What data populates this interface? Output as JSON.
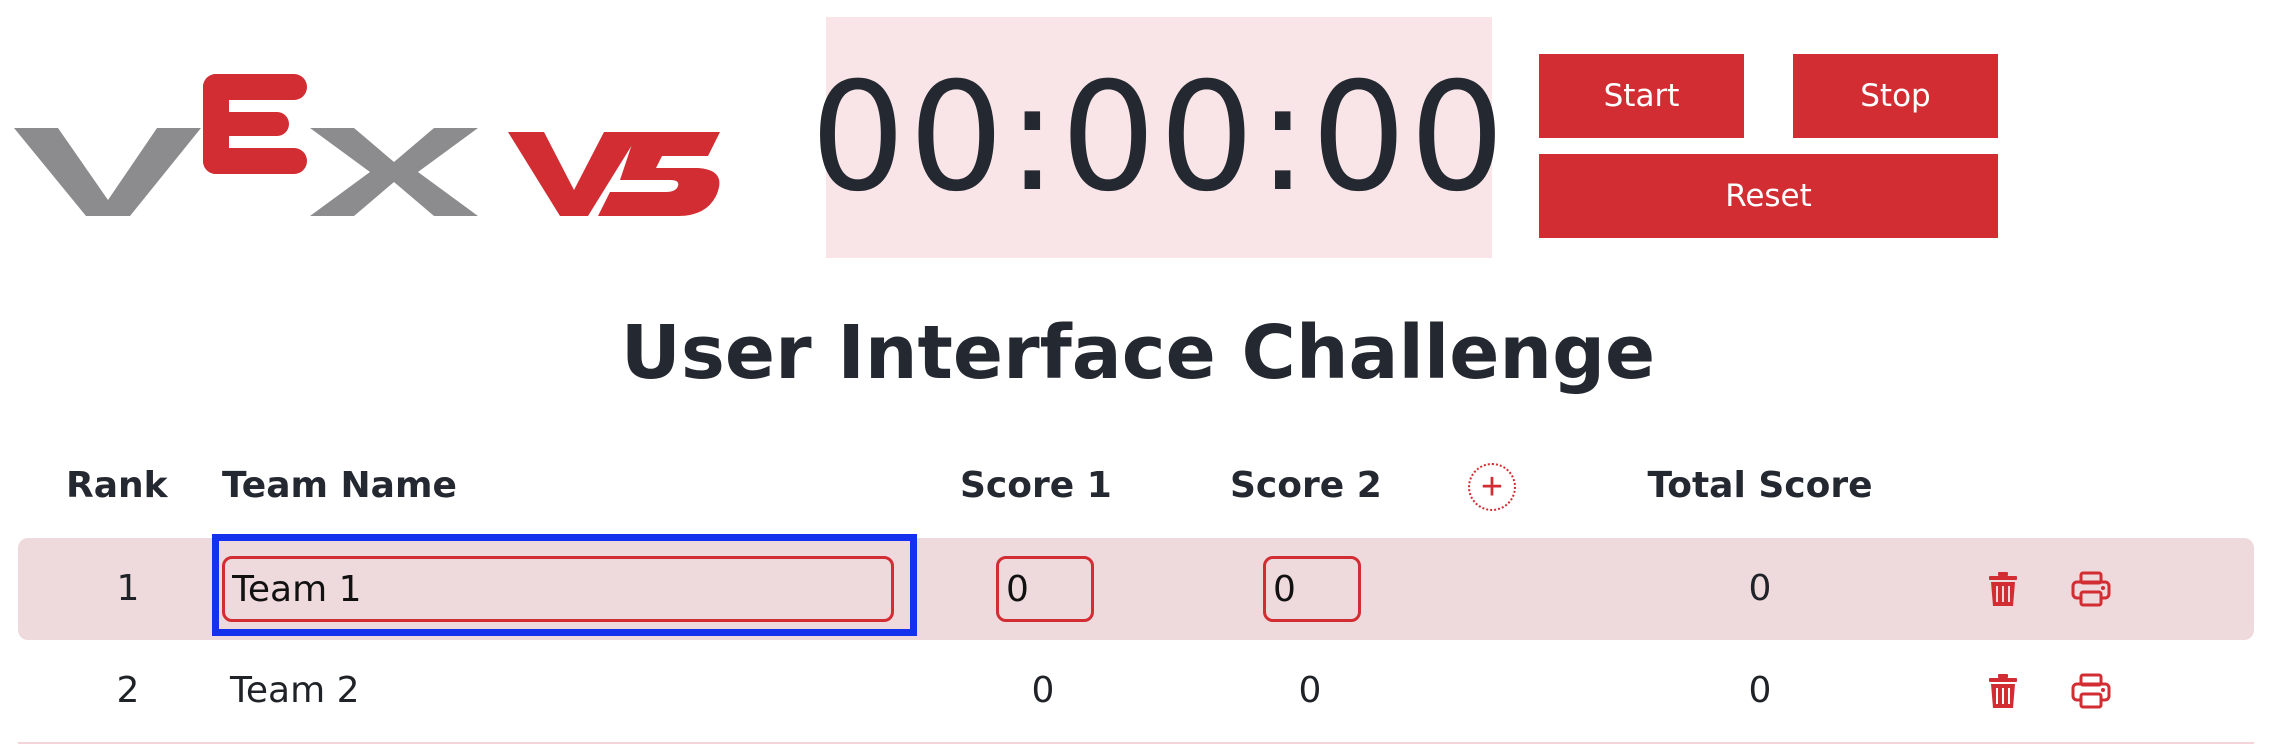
{
  "logo": {
    "text": "VEX V5",
    "gray_color": "#8c8c8e",
    "red_color": "#d12d33"
  },
  "timer": {
    "display": "00:00:00",
    "background": "#f9e5e7"
  },
  "controls": {
    "start_label": "Start",
    "stop_label": "Stop",
    "reset_label": "Reset",
    "color": "#d12d33"
  },
  "title": "User Interface Challenge",
  "table": {
    "headers": {
      "rank": "Rank",
      "team_name": "Team Name",
      "score1": "Score 1",
      "score2": "Score 2",
      "total": "Total Score"
    },
    "add_icon": "plus-circle-icon",
    "rows": [
      {
        "rank": "1",
        "team_name": "Team 1",
        "score1": "0",
        "score2": "0",
        "total": "0",
        "editing": true
      },
      {
        "rank": "2",
        "team_name": "Team 2",
        "score1": "0",
        "score2": "0",
        "total": "0",
        "editing": false
      }
    ],
    "row_icons": [
      "trash-icon",
      "printer-icon"
    ],
    "highlight_color": "#eed9dc",
    "focus_color": "#1432ee"
  }
}
